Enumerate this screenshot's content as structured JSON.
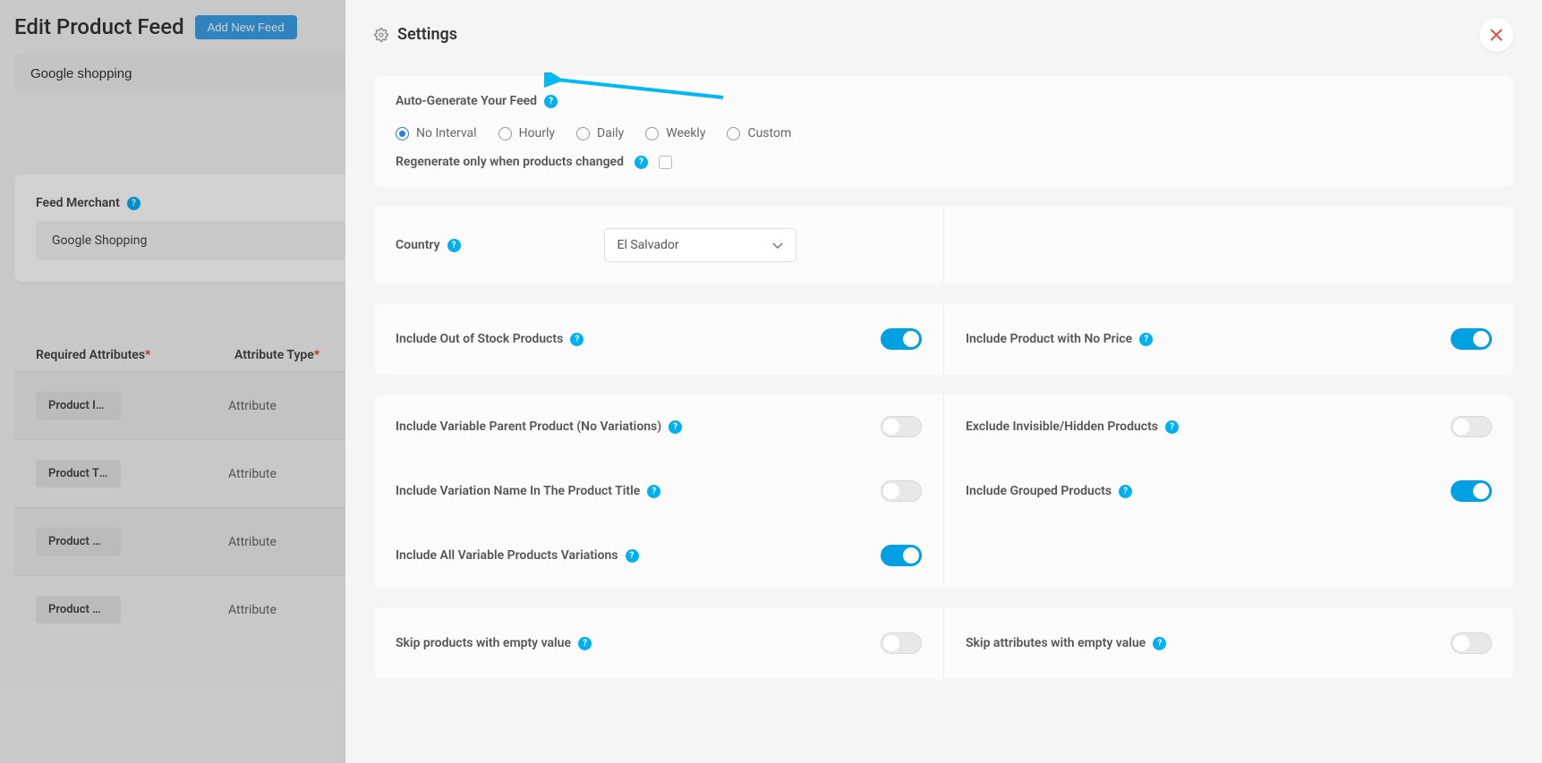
{
  "page": {
    "title": "Edit Product Feed",
    "add_feed_btn": "Add New Feed",
    "feed_name": "Google shopping",
    "merchant_label": "Feed Merchant",
    "merchant_value": "Google Shopping",
    "table": {
      "col_required": "Required Attributes",
      "col_type": "Attribute Type",
      "rows": [
        {
          "tag": "Product Id [id]",
          "type": "Attribute"
        },
        {
          "tag": "Product Title …",
          "type": "Attribute"
        },
        {
          "tag": "Product Desc…",
          "type": "Attribute"
        },
        {
          "tag": "Product URL …",
          "type": "Attribute"
        }
      ]
    }
  },
  "settings": {
    "title": "Settings",
    "auto_gen": {
      "label": "Auto-Generate Your Feed",
      "options": [
        "No Interval",
        "Hourly",
        "Daily",
        "Weekly",
        "Custom"
      ],
      "selected": "No Interval",
      "regen_label": "Regenerate only when products changed"
    },
    "country": {
      "label": "Country",
      "value": "El Salvador"
    },
    "toggles": {
      "out_of_stock": {
        "label": "Include Out of Stock Products",
        "on": true
      },
      "no_price": {
        "label": "Include Product with No Price",
        "on": true
      },
      "variable_parent": {
        "label": "Include Variable Parent Product (No Variations)",
        "on": false
      },
      "exclude_hidden": {
        "label": "Exclude Invisible/Hidden Products",
        "on": false
      },
      "variation_name": {
        "label": "Include Variation Name In The Product Title",
        "on": false
      },
      "grouped": {
        "label": "Include Grouped Products",
        "on": true
      },
      "all_variable": {
        "label": "Include All Variable Products Variations",
        "on": true
      },
      "skip_products_empty": {
        "label": "Skip products with empty value",
        "on": false
      },
      "skip_attrs_empty": {
        "label": "Skip attributes with empty value",
        "on": false
      }
    }
  }
}
